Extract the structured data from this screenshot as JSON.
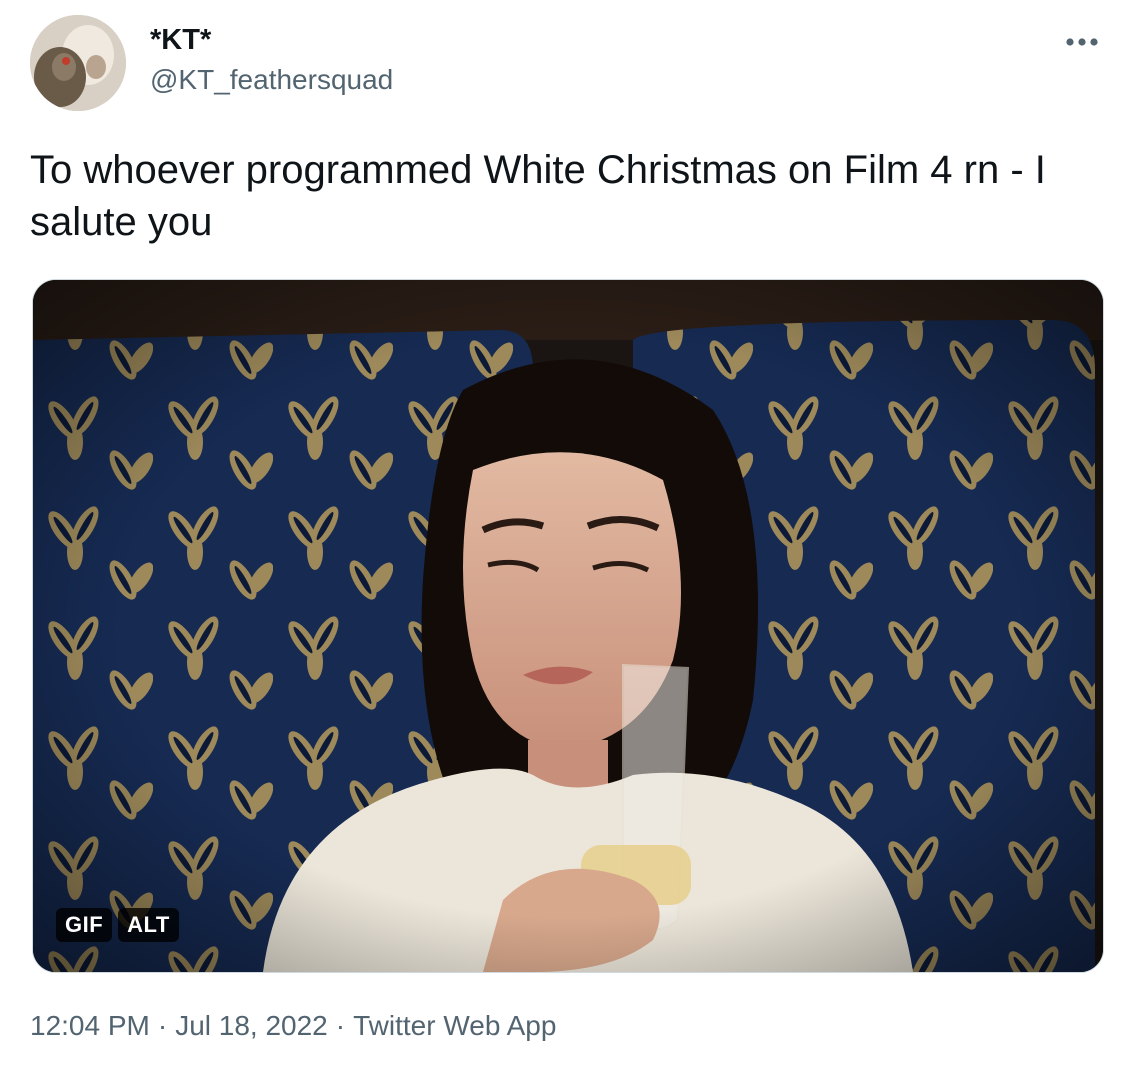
{
  "author": {
    "display_name": "*KT*",
    "handle": "@KT_feathersquad",
    "avatar_icon": "avatar-photo"
  },
  "more_icon": "more-horizontal-icon",
  "tweet": {
    "text": "To whoever programmed White Christmas on Film 4 rn - I salute you",
    "media": {
      "badges": [
        "GIF",
        "ALT"
      ]
    }
  },
  "meta": {
    "time": "12:04 PM",
    "separator": "·",
    "date": "Jul 18, 2022",
    "source": "Twitter Web App"
  },
  "colors": {
    "text_primary": "#0f1419",
    "text_secondary": "#536471",
    "media_border": "#cfd9de"
  }
}
